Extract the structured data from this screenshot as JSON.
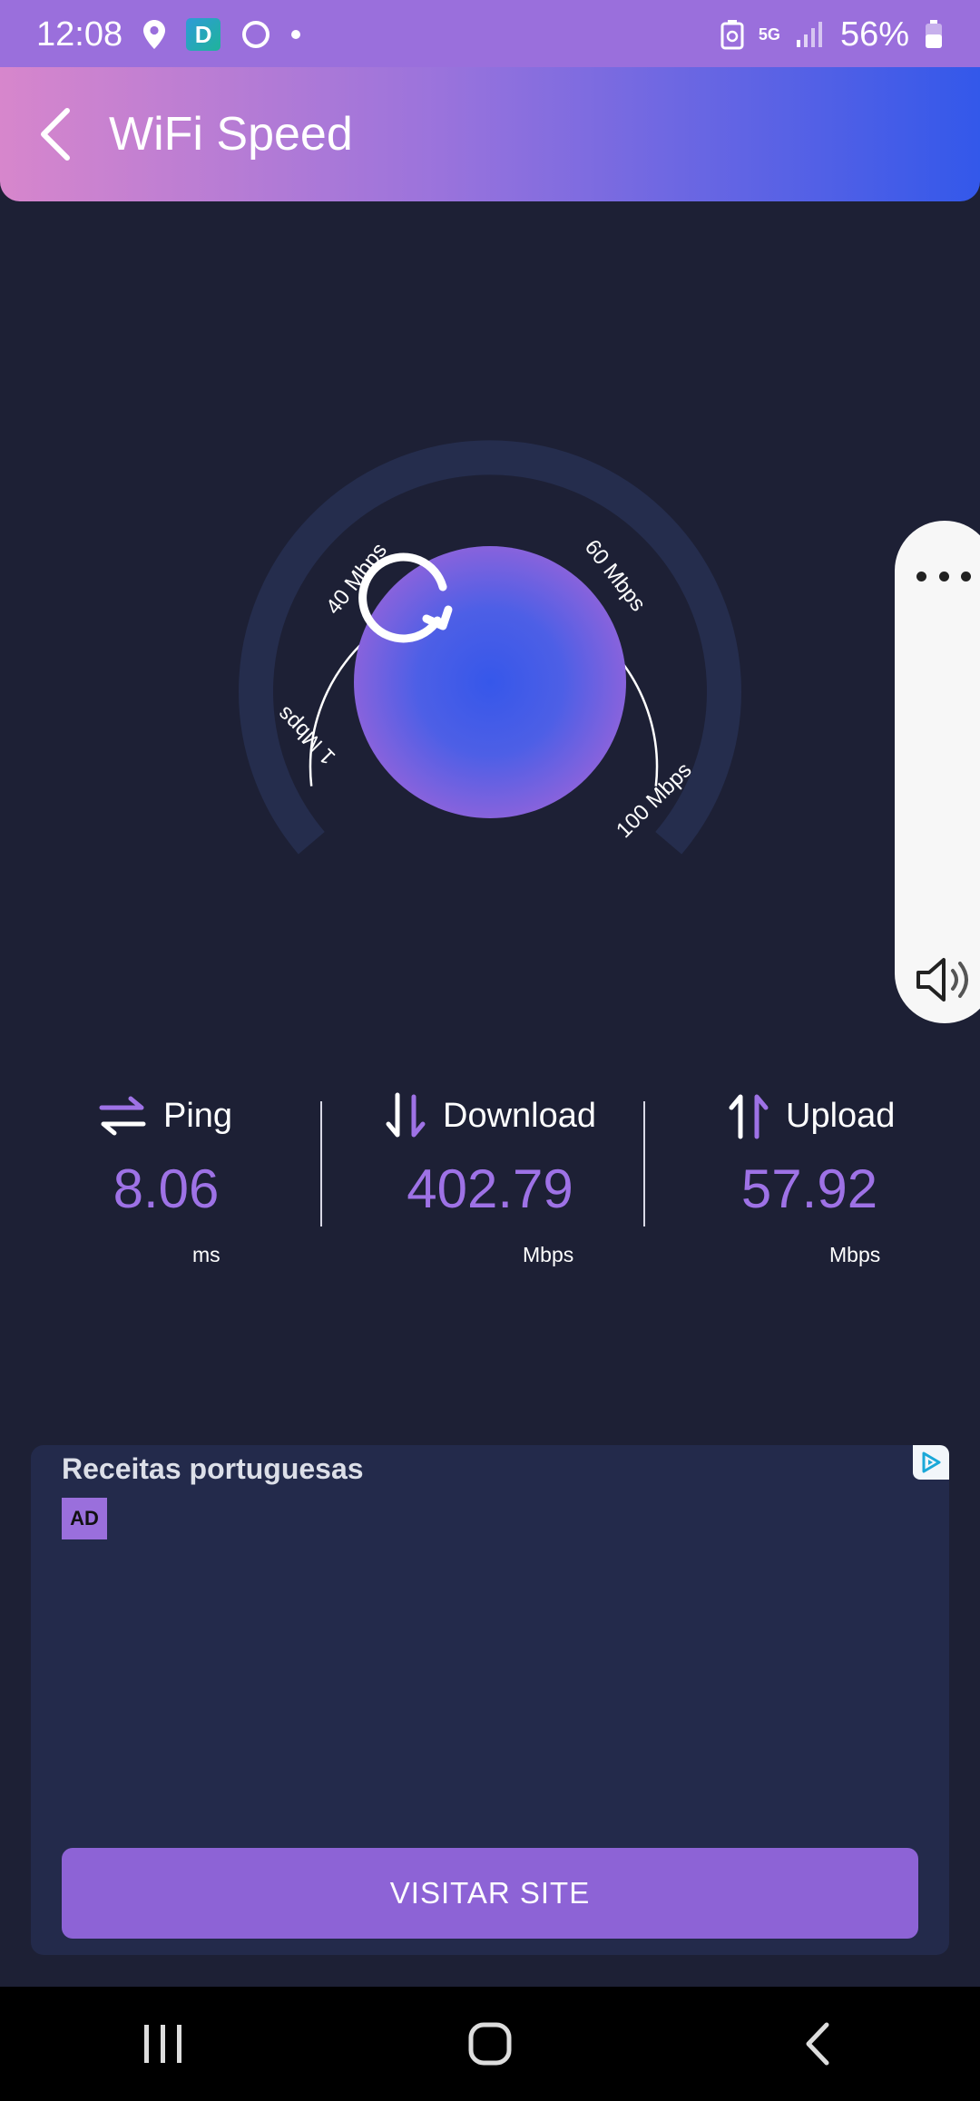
{
  "status_bar": {
    "time": "12:08",
    "network": "5G",
    "battery": "56%",
    "icons": [
      "location-icon",
      "app-icon",
      "circle-icon",
      "dot-icon",
      "battery-saver-icon",
      "5g-icon",
      "signal-icon",
      "battery-icon"
    ],
    "app_badge_letter": "D"
  },
  "header": {
    "title": "WiFi Speed",
    "back_icon": "back-arrow-icon"
  },
  "gauge": {
    "scale_labels": [
      "1 Mbps",
      "40 Mbps",
      "60 Mbps",
      "100 Mbps"
    ],
    "button_icon": "refresh-icon"
  },
  "side_panel": {
    "icons": [
      "more-icon",
      "volume-icon"
    ]
  },
  "stats": {
    "ping": {
      "label": "Ping",
      "value": "8.06",
      "unit": "ms",
      "icon": "swap-arrows-icon"
    },
    "download": {
      "label": "Download",
      "value": "402.79",
      "unit": "Mbps",
      "icon": "download-arrows-icon"
    },
    "upload": {
      "label": "Upload",
      "value": "57.92",
      "unit": "Mbps",
      "icon": "upload-arrows-icon"
    }
  },
  "ad": {
    "title": "Receitas portuguesas",
    "badge": "AD",
    "cta": "VISITAR SITE",
    "choices_icon": "adchoices-icon"
  },
  "nav_bar": {
    "icons": [
      "recents-icon",
      "home-icon",
      "back-icon"
    ]
  },
  "colors": {
    "background": "#1d2035",
    "accent": "#9e72e6",
    "status_bar": "#9a6fdc",
    "header_gradient_start": "#d786cc",
    "header_gradient_end": "#3358ea",
    "ad_background": "#232a4b"
  }
}
